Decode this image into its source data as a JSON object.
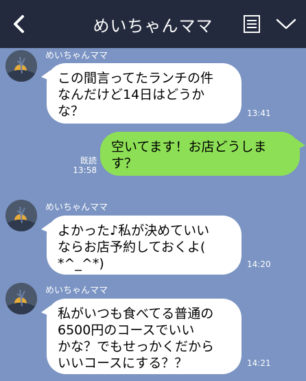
{
  "header": {
    "title": "めいちゃんママ"
  },
  "messages": [
    {
      "sender": "めいちゃんママ",
      "text": "この間言ってたランチの件\nなんだけど14日はどうか\nな？",
      "time": "13:41"
    },
    {
      "sender": "me",
      "text": "空いてます！お店どうしま\nす？",
      "read": "既読",
      "time": "13:58"
    },
    {
      "sender": "めいちゃんママ",
      "text": "よかった♪私が決めていい\nならお店予約しておくよ(\n*^_^*)",
      "time": "14:20"
    },
    {
      "sender": "めいちゃんママ",
      "text": "私がいつも食べてる普通の\n6500円のコースでいい\nかな？でもせっかくだから\nいいコースにする？？",
      "time": "14:21"
    }
  ],
  "colors": {
    "header": "#232a3d",
    "background": "#7b94c3",
    "incoming": "#ffffff",
    "outgoing": "#8de055"
  },
  "icons": [
    "back-icon",
    "menu-icon",
    "chevron-down-icon",
    "avatar"
  ]
}
